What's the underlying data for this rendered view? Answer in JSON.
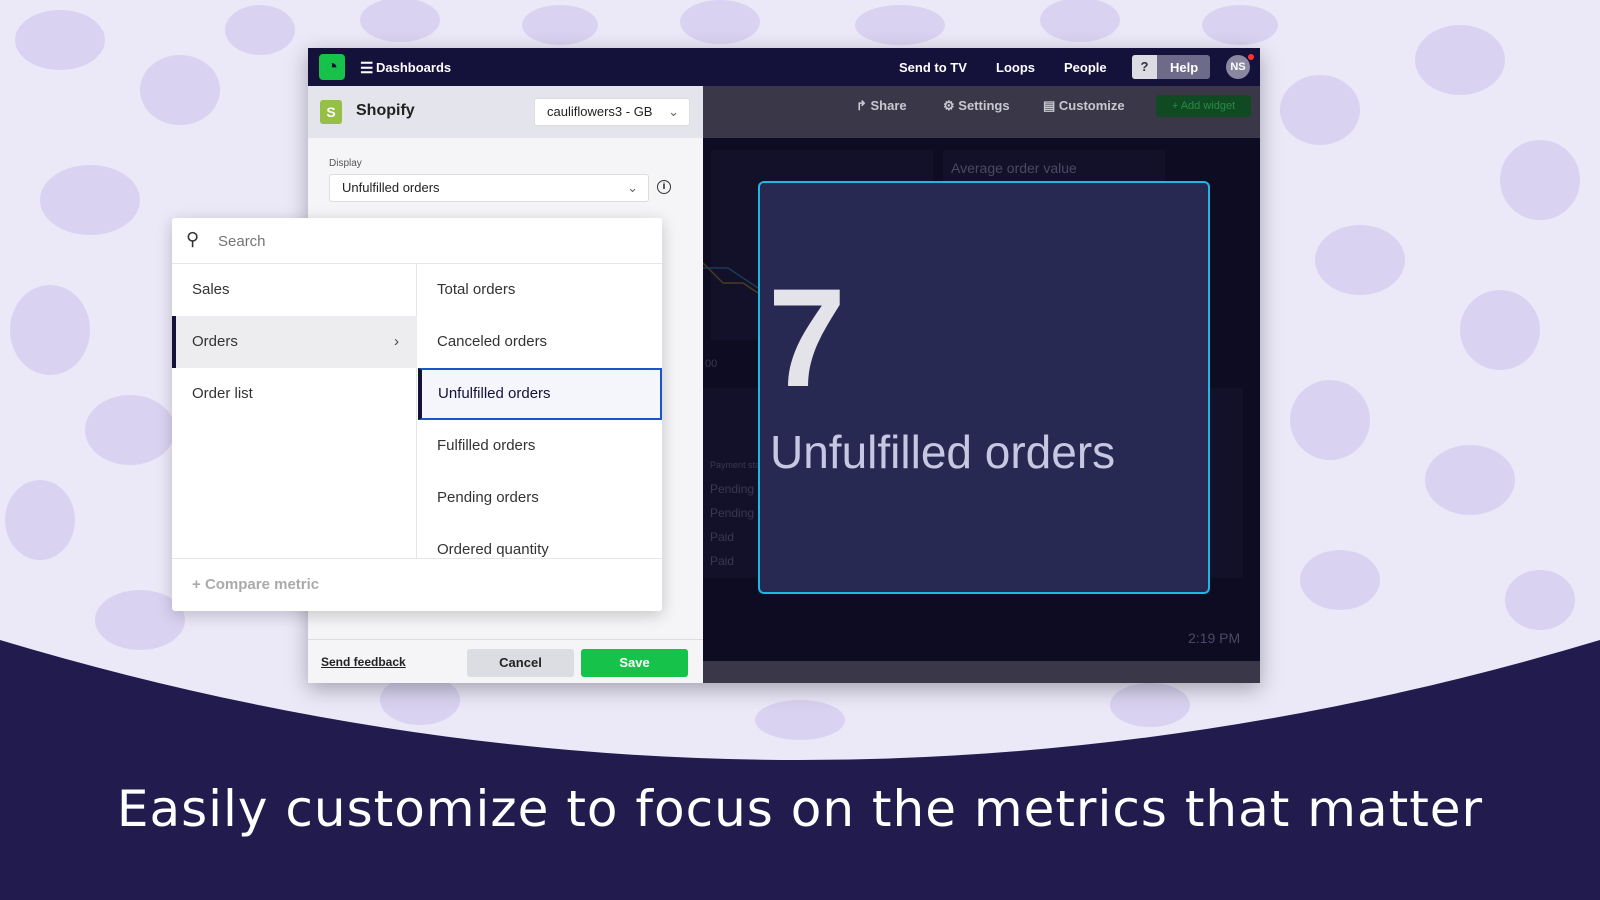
{
  "topbar": {
    "menu_icon": "hamburger-icon",
    "dashboards": "Dashboards",
    "send_to_tv": "Send to TV",
    "loops": "Loops",
    "people": "People",
    "help_q": "?",
    "help": "Help",
    "avatar": "NS"
  },
  "panel": {
    "title": "Shopify",
    "account": "cauliflowers3 - GB",
    "display_label": "Display",
    "display_value": "Unfulfilled orders",
    "send_feedback": "Send feedback",
    "cancel": "Cancel",
    "save": "Save"
  },
  "popup": {
    "search_placeholder": "Search",
    "categories": [
      {
        "label": "Sales"
      },
      {
        "label": "Orders"
      },
      {
        "label": "Order list"
      }
    ],
    "metrics": [
      {
        "label": "Total orders"
      },
      {
        "label": "Canceled orders"
      },
      {
        "label": "Unfulfilled orders"
      },
      {
        "label": "Fulfilled orders"
      },
      {
        "label": "Pending orders"
      },
      {
        "label": "Ordered quantity"
      }
    ],
    "compare": "Compare metric"
  },
  "dashboard": {
    "share": "Share",
    "settings": "Settings",
    "customize": "Customize",
    "add_widget": "Add widget",
    "bg_widget_title": "Average order value",
    "payment_header": "Payment sta",
    "payments": [
      "Pending",
      "Pending",
      "Paid",
      "Paid"
    ],
    "axis_fragment": "00",
    "time": "2:19 PM",
    "widget_value": "7",
    "widget_label": "Unfulfilled orders"
  },
  "caption": "Easily customize to focus on the metrics that matter",
  "colors": {
    "brand_green": "#17c24a",
    "navy": "#221c4e",
    "accent_blue": "#1fb6e0",
    "selected_border": "#1a56c8"
  }
}
